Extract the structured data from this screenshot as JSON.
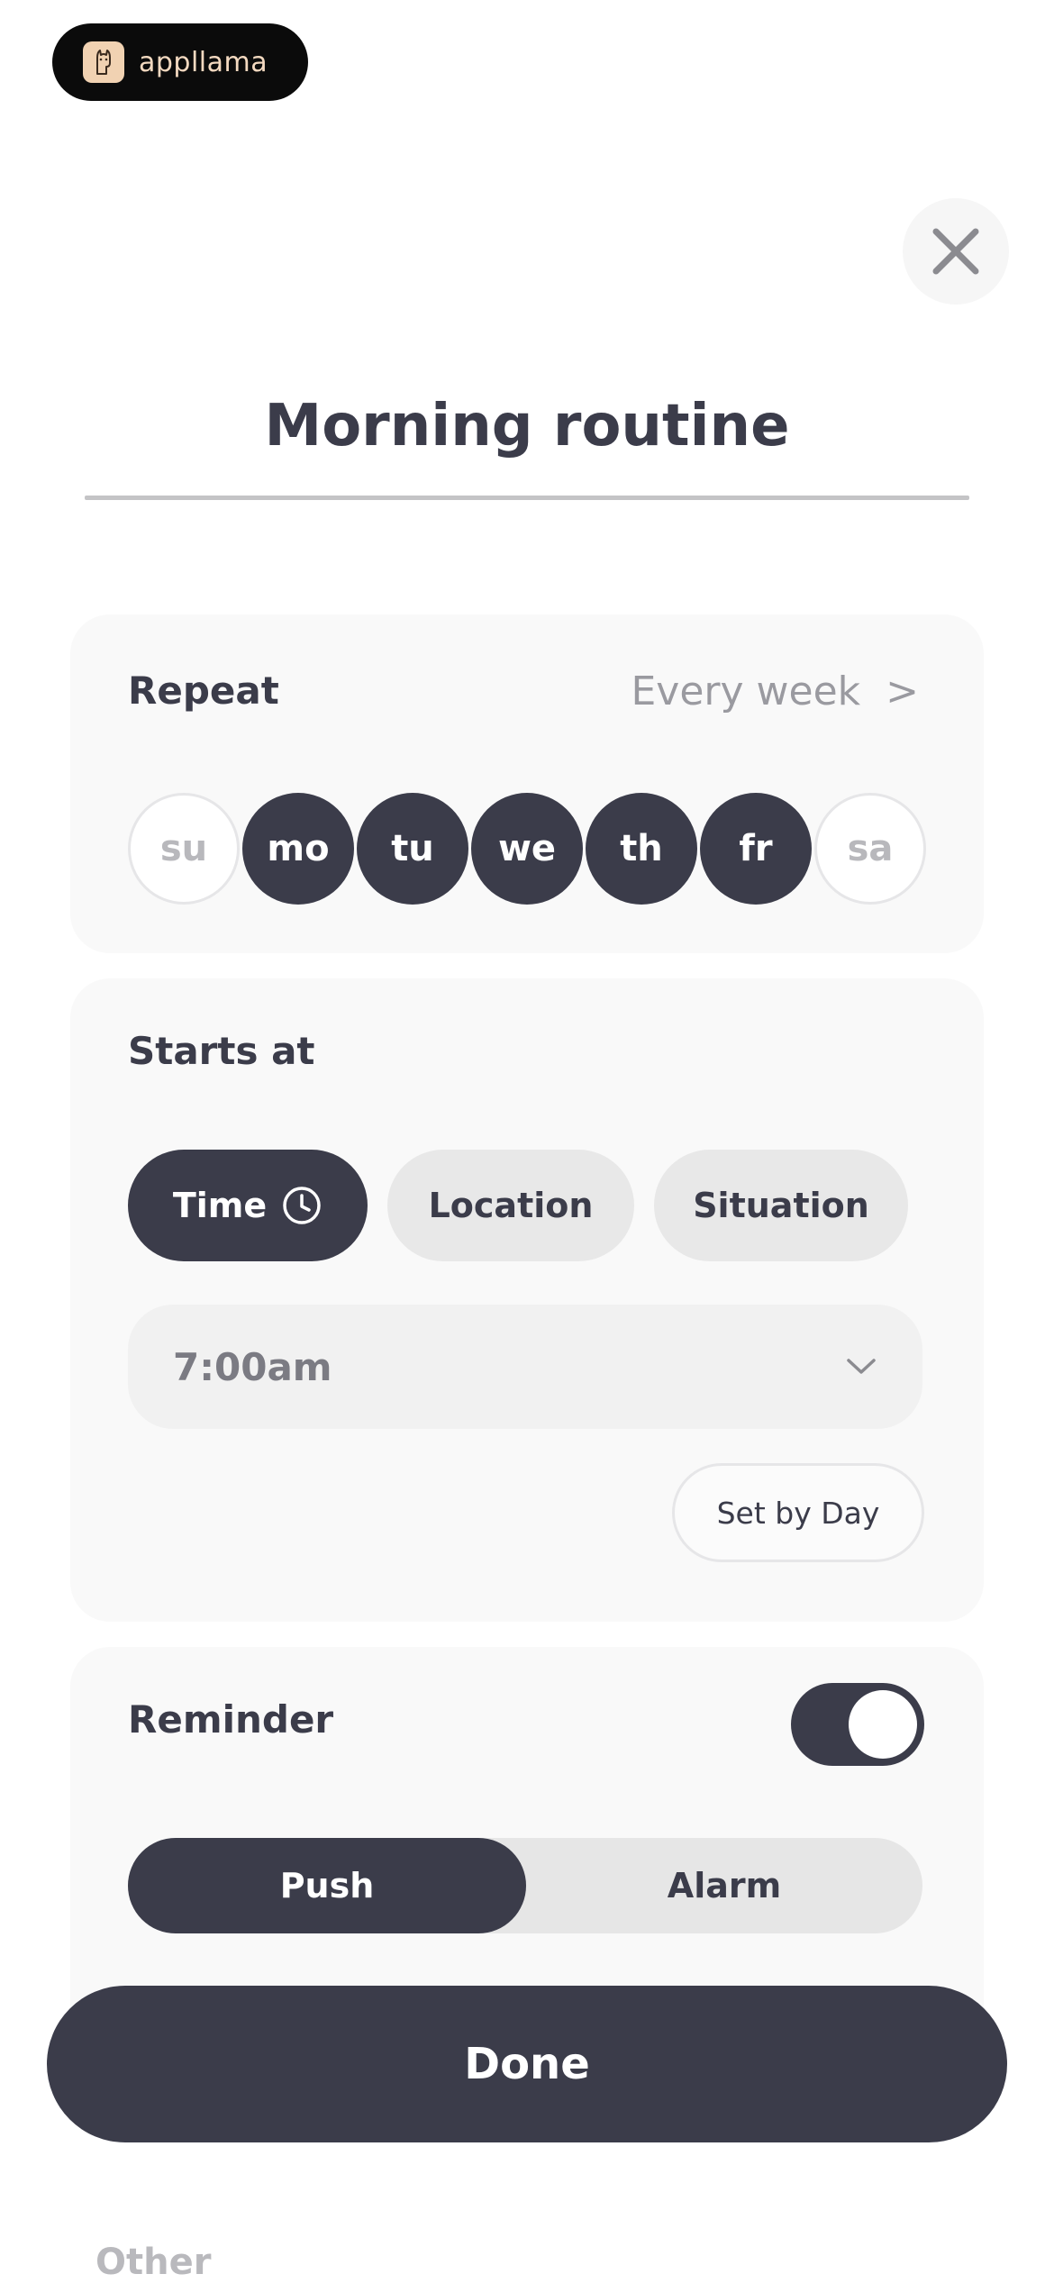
{
  "brand": {
    "name": "appllama",
    "icon": "llama-icon",
    "colors": {
      "badge_bg": "#0b0b0b",
      "text": "#f3d9c0",
      "mark_bg": "#f1d2b2"
    }
  },
  "header": {
    "close_icon": "close-icon"
  },
  "routine": {
    "title": "Morning routine"
  },
  "repeat": {
    "label": "Repeat",
    "value": "Every week",
    "chevron": ">",
    "days": [
      {
        "label": "su",
        "selected": false
      },
      {
        "label": "mo",
        "selected": true
      },
      {
        "label": "tu",
        "selected": true
      },
      {
        "label": "we",
        "selected": true
      },
      {
        "label": "th",
        "selected": true
      },
      {
        "label": "fr",
        "selected": true
      },
      {
        "label": "sa",
        "selected": false
      }
    ]
  },
  "starts_at": {
    "label": "Starts at",
    "options": [
      {
        "label": "Time",
        "selected": true,
        "icon": "clock-icon"
      },
      {
        "label": "Location",
        "selected": false
      },
      {
        "label": "Situation",
        "selected": false
      }
    ],
    "time_value": "7:00am",
    "set_by_day_label": "Set by Day"
  },
  "reminder": {
    "label": "Reminder",
    "enabled": true,
    "modes": [
      {
        "label": "Push",
        "selected": true
      },
      {
        "label": "Alarm",
        "selected": false
      }
    ]
  },
  "footer": {
    "done_label": "Done",
    "other_label": "Other"
  },
  "colors": {
    "primary": "#3b3c4a",
    "card_bg": "#f9f9f9",
    "chip_inactive": "#e8e8e8",
    "muted_text": "#9a9aa0"
  }
}
